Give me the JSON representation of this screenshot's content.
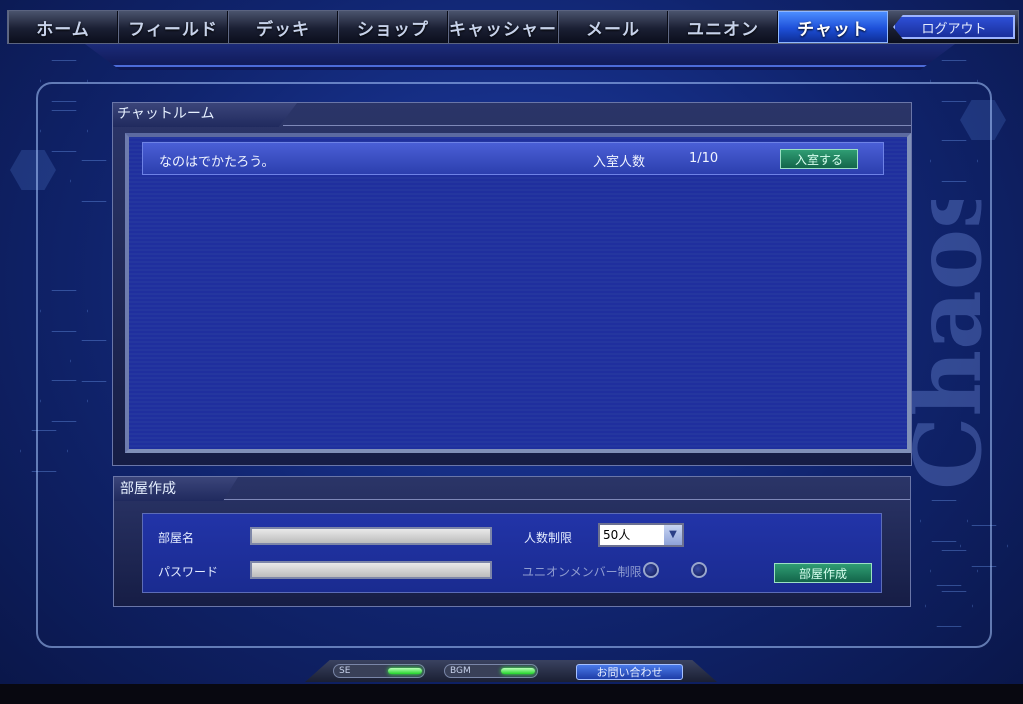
{
  "nav": {
    "tabs": [
      "ホーム",
      "フィールド",
      "デッキ",
      "ショップ",
      "キャッシャー",
      "メール",
      "ユニオン",
      "チャット"
    ],
    "active_index": 7,
    "logout_label": "ログアウト"
  },
  "background_logo": "Chaos",
  "chat_room": {
    "title": "チャットルーム",
    "rooms": [
      {
        "name": "なのはでかたろう。",
        "count_label": "入室人数",
        "count": "1/10",
        "enter_label": "入室する"
      }
    ]
  },
  "create_room": {
    "title": "部屋作成",
    "room_name_label": "部屋名",
    "password_label": "パスワード",
    "room_name_value": "",
    "password_value": "",
    "limit_label": "人数制限",
    "limit_value": "50人",
    "union_limit_label": "ユニオンメンバー制限",
    "create_button": "部屋作成"
  },
  "footer": {
    "se_label": "SE",
    "bgm_label": "BGM",
    "contact_label": "お問い合わせ"
  },
  "colors": {
    "accent_blue": "#1d4fd8",
    "button_green": "#13654a",
    "led_green": "#22d42a"
  }
}
